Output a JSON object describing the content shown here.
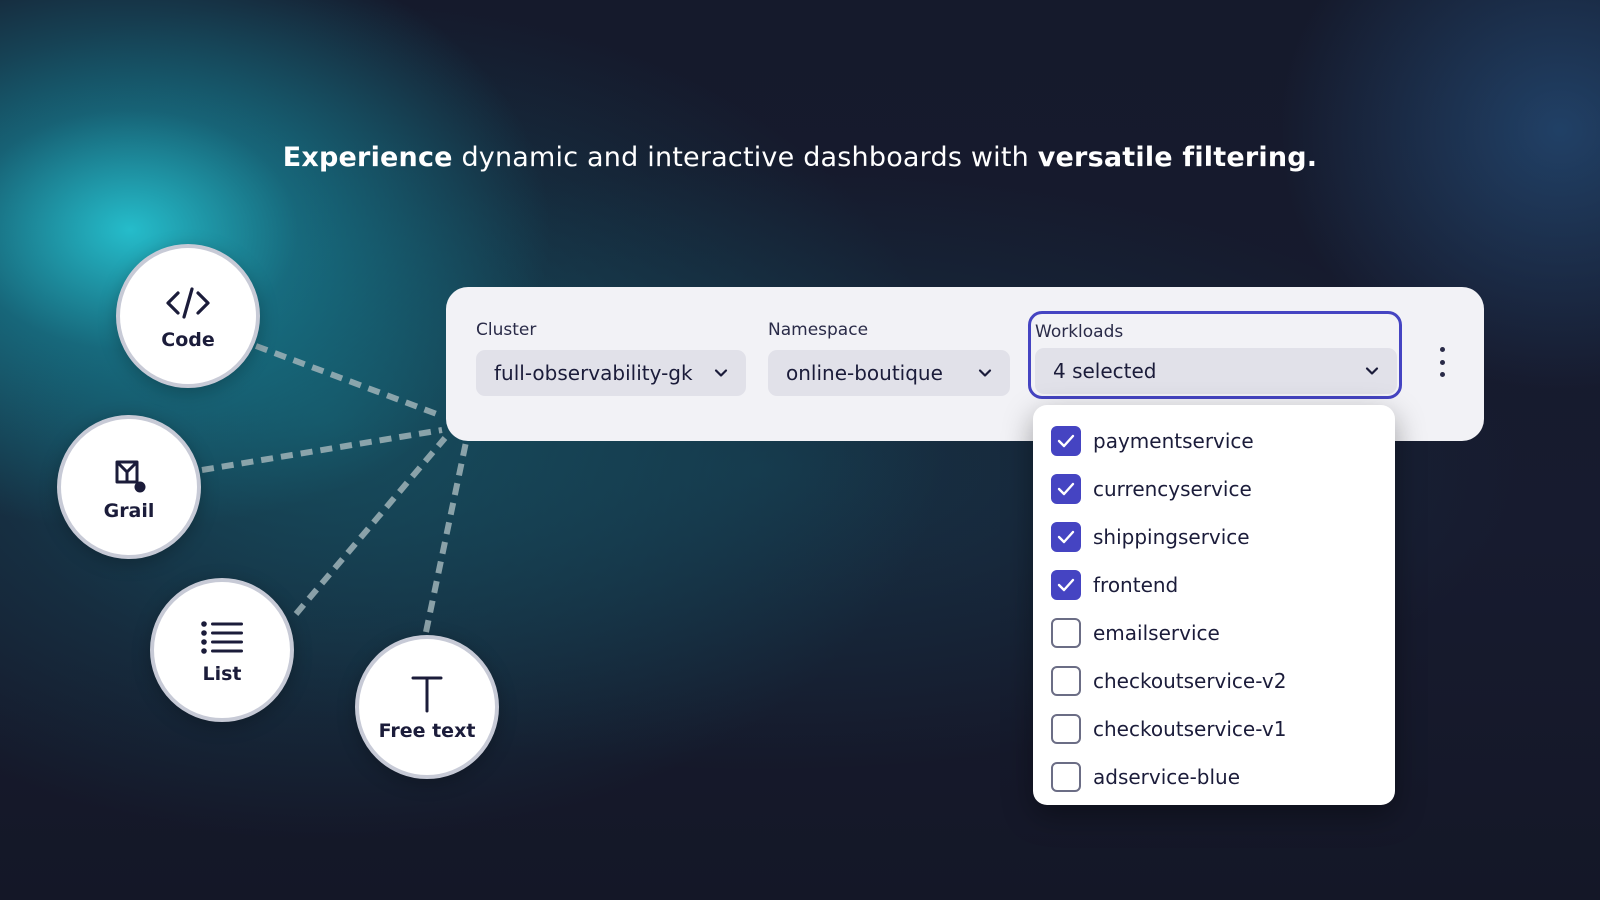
{
  "headline": {
    "bold_start": "Experience",
    "middle": " dynamic and interactive dashboards with ",
    "bold_end": "versatile filtering."
  },
  "variable_types": [
    {
      "label": "Code",
      "icon": "code-icon"
    },
    {
      "label": "Grail",
      "icon": "grail-icon"
    },
    {
      "label": "List",
      "icon": "list-icon"
    },
    {
      "label": "Free text",
      "icon": "text-icon"
    }
  ],
  "filters": {
    "cluster": {
      "label": "Cluster",
      "value": "full-observability-gk"
    },
    "namespace": {
      "label": "Namespace",
      "value": "online-boutique"
    },
    "workloads": {
      "label": "Workloads",
      "value": "4 selected"
    }
  },
  "workload_options": [
    {
      "label": "paymentservice",
      "checked": true
    },
    {
      "label": "currencyservice",
      "checked": true
    },
    {
      "label": "shippingservice",
      "checked": true
    },
    {
      "label": "frontend",
      "checked": true
    },
    {
      "label": "emailservice",
      "checked": false
    },
    {
      "label": "checkoutservice-v2",
      "checked": false
    },
    {
      "label": "checkoutservice-v1",
      "checked": false
    },
    {
      "label": "adservice-blue",
      "checked": false
    }
  ],
  "colors": {
    "accent": "#4544c2",
    "panel": "#f2f2f6",
    "background": "#161a2d"
  }
}
